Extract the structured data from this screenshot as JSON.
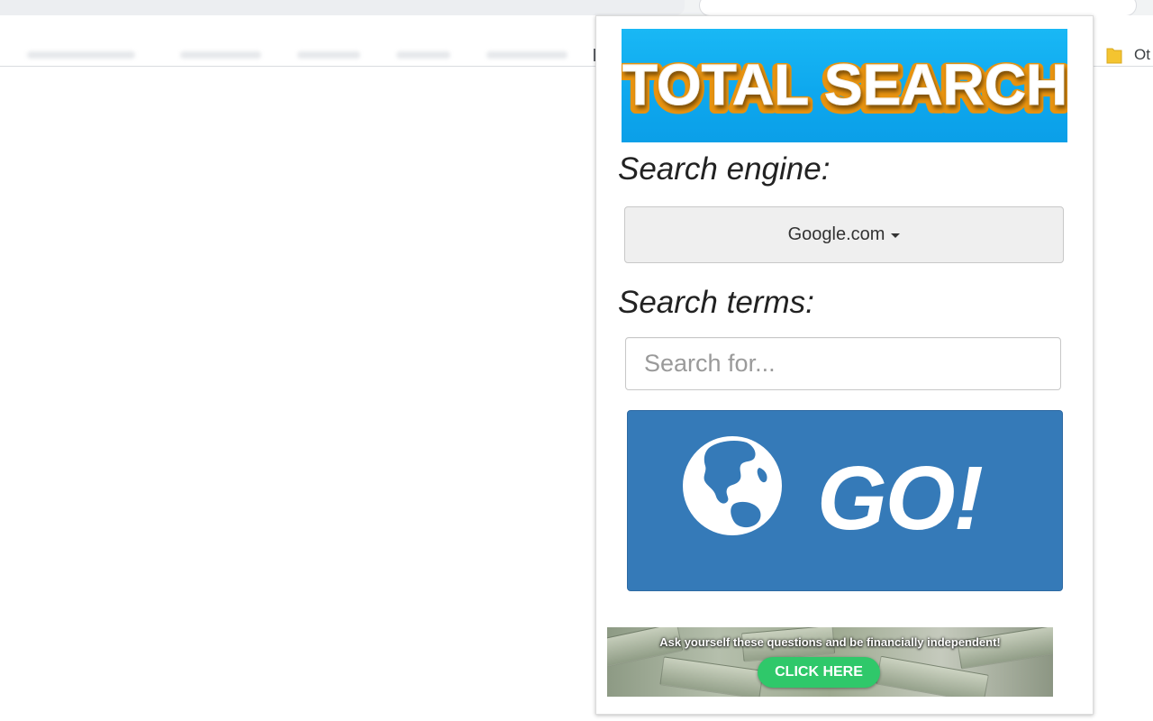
{
  "browser": {
    "bookmarks_bar": {
      "other_bookmarks_label": "Ot",
      "folder_icon": "folder-icon"
    }
  },
  "popup": {
    "header_banner": {
      "title": "TOTAL SEARCH",
      "colors": {
        "background": "#0ea8ee",
        "text": "#ffffff",
        "outline": "#e8930f"
      }
    },
    "engine_label": "Search engine:",
    "engine_dropdown": {
      "selected": "Google.com",
      "icon": "caret-down-icon"
    },
    "terms_label": "Search terms:",
    "search_input": {
      "value": "",
      "placeholder": "Search for..."
    },
    "go_button": {
      "label": "GO!",
      "icon": "globe-icon",
      "color": "#357ab8"
    },
    "ad_banner": {
      "headline": "Ask yourself these questions and be financially independent!",
      "cta_label": "CLICK HERE",
      "cta_color": "#2fc86a"
    }
  }
}
